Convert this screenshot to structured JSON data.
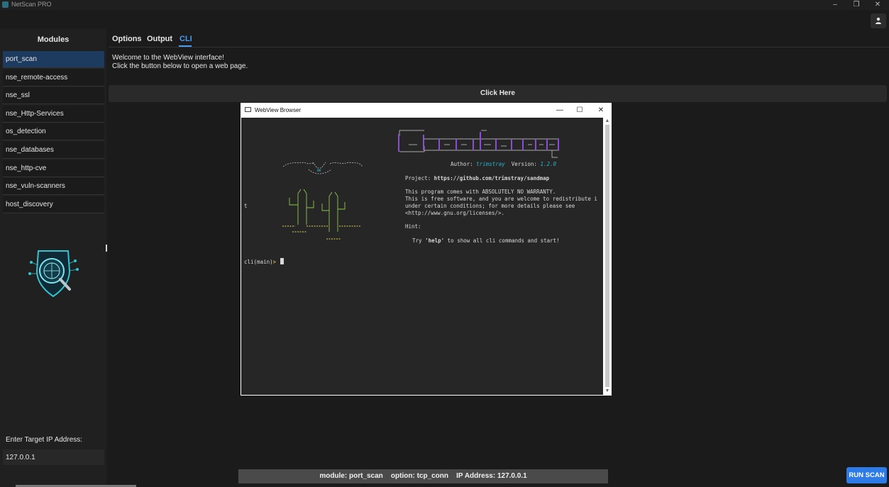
{
  "window": {
    "title": "NetScan PRO",
    "minimize": "–",
    "maximize": "❐",
    "close": "✕"
  },
  "sidebar": {
    "heading": "Modules",
    "modules": [
      "port_scan",
      "nse_remote-access",
      "nse_ssl",
      "nse_Http-Services",
      "os_detection",
      "nse_databases",
      "nse_http-cve",
      "nse_vuln-scanners",
      "host_discovery"
    ],
    "active_module": "port_scan",
    "target_label": "Enter Target IP Address:",
    "target_value": "127.0.0.1"
  },
  "tabs": {
    "options": "Options",
    "output": "Output",
    "cli": "CLI",
    "active": "CLI"
  },
  "welcome": {
    "line1": "Welcome to the WebView interface!",
    "line2": "Click the button below to open a web page."
  },
  "click_button": "Click Here",
  "webview": {
    "title": "WebView Browser",
    "minimize": "—",
    "maximize": "☐",
    "close": "✕",
    "terminal": {
      "author_label": "Author:",
      "author": "trimstray",
      "version_label": "Version:",
      "version": "1.2.0",
      "project_label": "Project:",
      "project_url": "https://github.com/trimstray/sandmap",
      "license_1": "This program comes with ABSOLUTELY NO WARRANTY.",
      "license_2": "This is free software, and you are welcome to redistribute i",
      "license_3": "under certain conditions; for more details please see",
      "license_4": "<http://www.gnu.org/licenses/>.",
      "hint_label": "Hint:",
      "hint_pre": "Try ",
      "hint_cmd": "'help'",
      "hint_post": " to show all cli commands and start!",
      "stray_char": "t",
      "prompt": "cli(main)",
      "prompt_symbol": ">"
    }
  },
  "status": {
    "module_label": "module:",
    "module": "port_scan",
    "option_label": "option:",
    "option": "tcp_conn",
    "ip_label": "IP Address:",
    "ip": "127.0.0.1"
  },
  "run_button": "RUN SCAN",
  "icons": [
    "app-icon",
    "user-icon",
    "shield-logo-icon",
    "webview-app-icon",
    "scroll-up-icon",
    "scroll-down-icon"
  ],
  "colors": {
    "accent": "#4a9cf0",
    "active_module": "#1d3a5f",
    "run_button": "#2d7be6",
    "terminal_cyan": "#2bb3c9",
    "terminal_green": "#8fc84a",
    "terminal_yellow": "#e3d25a"
  }
}
